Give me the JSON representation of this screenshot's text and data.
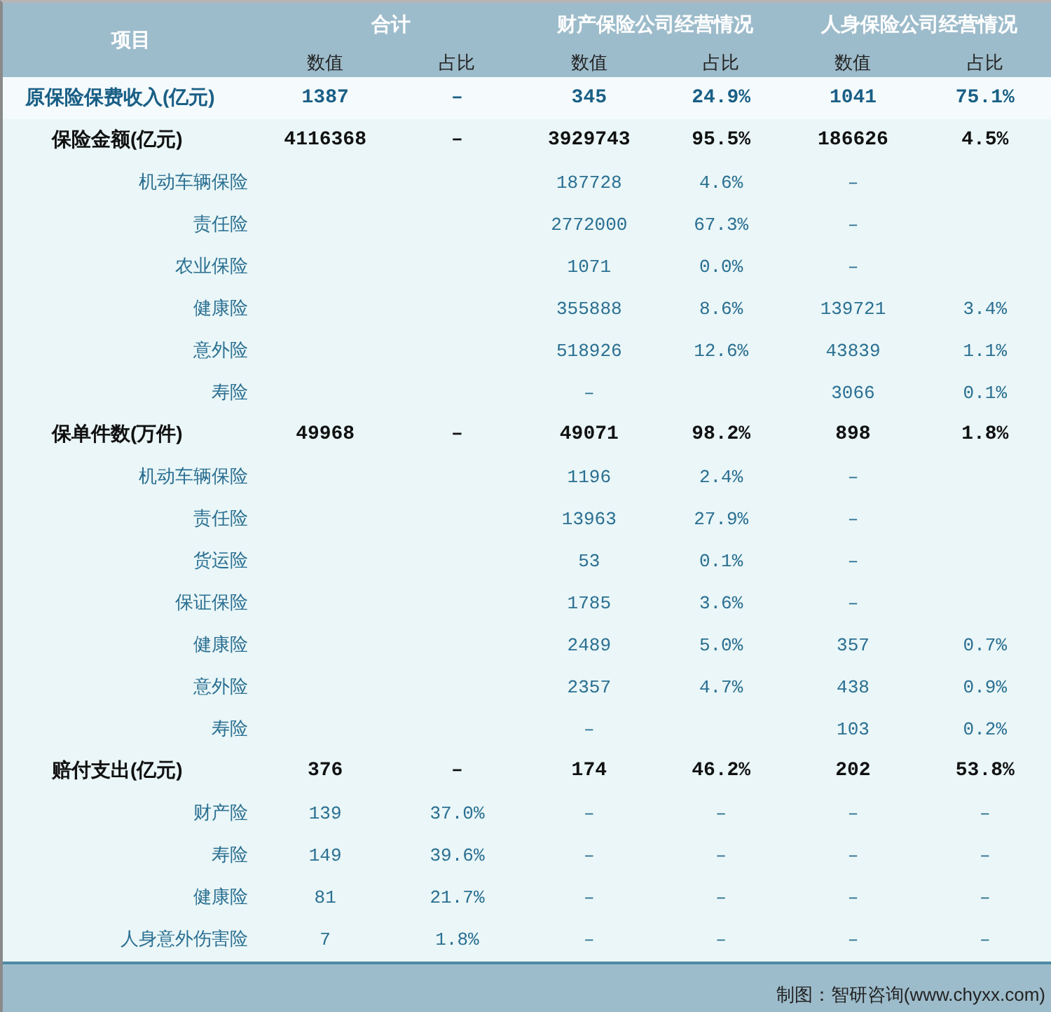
{
  "header": {
    "item_label": "项目",
    "groups": [
      {
        "title": "合计",
        "columns": [
          "数值",
          "占比"
        ]
      },
      {
        "title": "财产保险公司经营情况",
        "columns": [
          "数值",
          "占比"
        ]
      },
      {
        "title": "人身保险公司经营情况",
        "columns": [
          "数值",
          "占比"
        ]
      }
    ]
  },
  "rows": [
    {
      "kind": "lead",
      "label": "原保险保费收入(亿元)",
      "cells": [
        "1387",
        "–",
        "345",
        "24.9%",
        "1041",
        "75.1%"
      ]
    },
    {
      "kind": "section",
      "label": "保险金额(亿元)",
      "cells": [
        "4116368",
        "–",
        "3929743",
        "95.5%",
        "186626",
        "4.5%"
      ]
    },
    {
      "kind": "item",
      "label": "机动车辆保险",
      "cells": [
        null,
        null,
        "187728",
        "4.6%",
        "–",
        null
      ]
    },
    {
      "kind": "item",
      "label": "责任险",
      "cells": [
        null,
        null,
        "2772000",
        "67.3%",
        "–",
        null
      ]
    },
    {
      "kind": "item",
      "label": "农业保险",
      "cells": [
        null,
        null,
        "1071",
        "0.0%",
        "–",
        null
      ]
    },
    {
      "kind": "item",
      "label": "健康险",
      "cells": [
        null,
        null,
        "355888",
        "8.6%",
        "139721",
        "3.4%"
      ]
    },
    {
      "kind": "item",
      "label": "意外险",
      "cells": [
        null,
        null,
        "518926",
        "12.6%",
        "43839",
        "1.1%"
      ]
    },
    {
      "kind": "item",
      "label": "寿险",
      "cells": [
        null,
        null,
        "–",
        null,
        "3066",
        "0.1%"
      ]
    },
    {
      "kind": "section",
      "label": "保单件数(万件)",
      "cells": [
        "49968",
        "–",
        "49071",
        "98.2%",
        "898",
        "1.8%"
      ]
    },
    {
      "kind": "item",
      "label": "机动车辆保险",
      "cells": [
        null,
        null,
        "1196",
        "2.4%",
        "–",
        null
      ]
    },
    {
      "kind": "item",
      "label": "责任险",
      "cells": [
        null,
        null,
        "13963",
        "27.9%",
        "–",
        null
      ]
    },
    {
      "kind": "item",
      "label": "货运险",
      "cells": [
        null,
        null,
        "53",
        "0.1%",
        "–",
        null
      ]
    },
    {
      "kind": "item",
      "label": "保证保险",
      "cells": [
        null,
        null,
        "1785",
        "3.6%",
        "–",
        null
      ]
    },
    {
      "kind": "item",
      "label": "健康险",
      "cells": [
        null,
        null,
        "2489",
        "5.0%",
        "357",
        "0.7%"
      ]
    },
    {
      "kind": "item",
      "label": "意外险",
      "cells": [
        null,
        null,
        "2357",
        "4.7%",
        "438",
        "0.9%"
      ]
    },
    {
      "kind": "item",
      "label": "寿险",
      "cells": [
        null,
        null,
        "–",
        null,
        "103",
        "0.2%"
      ]
    },
    {
      "kind": "section",
      "label": "赔付支出(亿元)",
      "cells": [
        "376",
        "–",
        "174",
        "46.2%",
        "202",
        "53.8%"
      ]
    },
    {
      "kind": "item",
      "label": "财产险",
      "cells": [
        "139",
        "37.0%",
        "–",
        "–",
        "–",
        "–"
      ]
    },
    {
      "kind": "item",
      "label": "寿险",
      "cells": [
        "149",
        "39.6%",
        "–",
        "–",
        "–",
        "–"
      ]
    },
    {
      "kind": "item",
      "label": "健康险",
      "cells": [
        "81",
        "21.7%",
        "–",
        "–",
        "–",
        "–"
      ]
    },
    {
      "kind": "item",
      "label": "人身意外伤害险",
      "cells": [
        "7",
        "1.8%",
        "–",
        "–",
        "–",
        "–"
      ]
    }
  ],
  "footer": {
    "credit": "制图：智研咨询(www.chyxx.com)"
  }
}
